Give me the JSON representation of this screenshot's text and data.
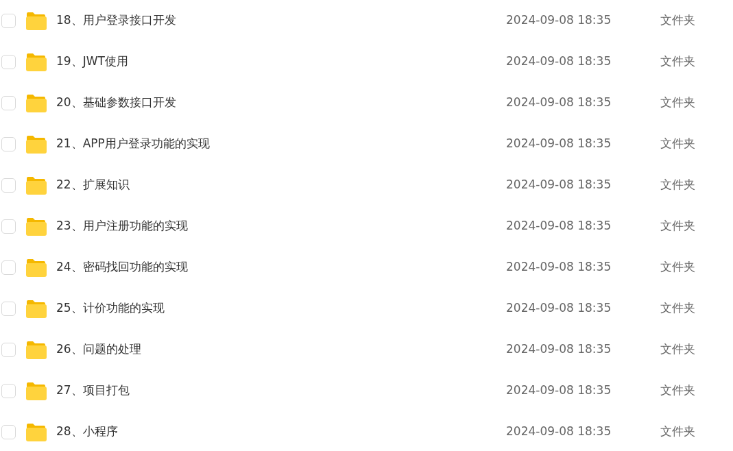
{
  "files": [
    {
      "name": "18、用户登录接口开发",
      "modified": "2024-09-08 18:35",
      "type": "文件夹",
      "selected": false
    },
    {
      "name": "19、JWT使用",
      "modified": "2024-09-08 18:35",
      "type": "文件夹",
      "selected": false
    },
    {
      "name": "20、基础参数接口开发",
      "modified": "2024-09-08 18:35",
      "type": "文件夹",
      "selected": false
    },
    {
      "name": "21、APP用户登录功能的实现",
      "modified": "2024-09-08 18:35",
      "type": "文件夹",
      "selected": false
    },
    {
      "name": "22、扩展知识",
      "modified": "2024-09-08 18:35",
      "type": "文件夹",
      "selected": false
    },
    {
      "name": "23、用户注册功能的实现",
      "modified": "2024-09-08 18:35",
      "type": "文件夹",
      "selected": false
    },
    {
      "name": "24、密码找回功能的实现",
      "modified": "2024-09-08 18:35",
      "type": "文件夹",
      "selected": false
    },
    {
      "name": "25、计价功能的实现",
      "modified": "2024-09-08 18:35",
      "type": "文件夹",
      "selected": false
    },
    {
      "name": "26、问题的处理",
      "modified": "2024-09-08 18:35",
      "type": "文件夹",
      "selected": false
    },
    {
      "name": "27、项目打包",
      "modified": "2024-09-08 18:35",
      "type": "文件夹",
      "selected": false
    },
    {
      "name": "28、小程序",
      "modified": "2024-09-08 18:35",
      "type": "文件夹",
      "selected": false
    }
  ]
}
